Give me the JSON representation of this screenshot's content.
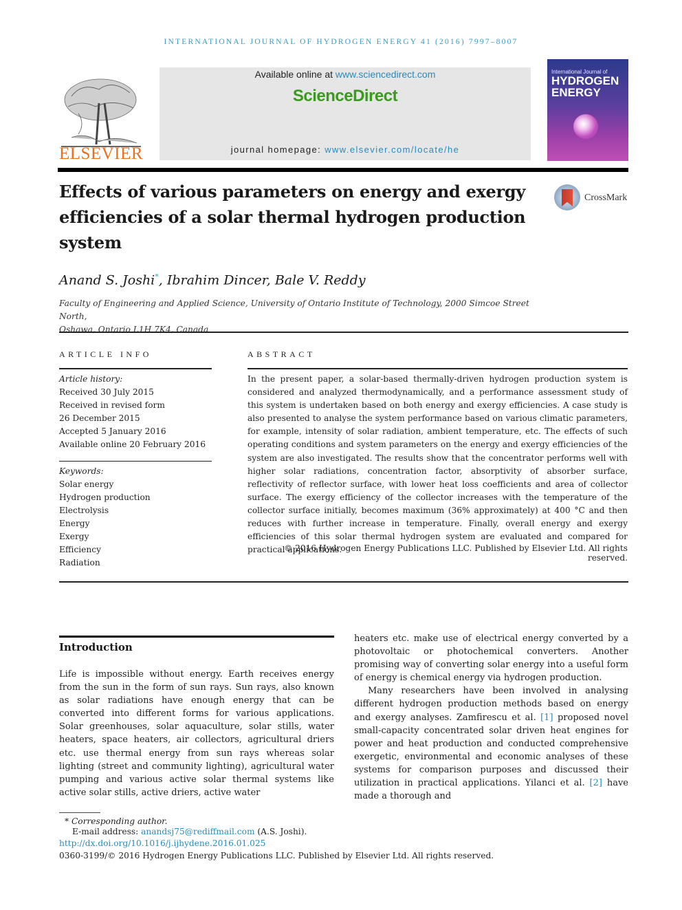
{
  "running_head": "INTERNATIONAL JOURNAL OF HYDROGEN ENERGY 41 (2016) 7997–8007",
  "header": {
    "publisher_logo": "ELSEVIER",
    "available_online_prefix": "Available online at ",
    "available_online_link": "www.sciencedirect.com",
    "brand": "ScienceDirect",
    "homepage_prefix": "journal homepage: ",
    "homepage_link": "www.elsevier.com/locate/he",
    "cover": {
      "line1": "International Journal of",
      "line2": "HYDROGEN",
      "line3": "ENERGY"
    }
  },
  "article": {
    "title": "Effects of various parameters on energy and exergy efficiencies of a solar thermal hydrogen production system",
    "crossmark_label": "CrossMark",
    "authors": [
      {
        "name": "Anand S. Joshi",
        "mark": "*"
      },
      {
        "name": "Ibrahim Dincer",
        "mark": ""
      },
      {
        "name": "Bale V. Reddy",
        "mark": ""
      }
    ],
    "author_sep": ", ",
    "affiliation_line1": "Faculty of Engineering and Applied Science, University of Ontario Institute of Technology, 2000 Simcoe Street North,",
    "affiliation_line2": "Oshawa, Ontario L1H 7K4, Canada"
  },
  "article_info": {
    "heading": "ARTICLE INFO",
    "history_label": "Article history:",
    "history": [
      "Received 30 July 2015",
      "Received in revised form",
      "26 December 2015",
      "Accepted 5 January 2016",
      "Available online 20 February 2016"
    ],
    "keywords_label": "Keywords:",
    "keywords": [
      "Solar energy",
      "Hydrogen production",
      "Electrolysis",
      "Energy",
      "Exergy",
      "Efficiency",
      "Radiation"
    ]
  },
  "abstract": {
    "heading": "ABSTRACT",
    "text": "In the present paper, a solar-based thermally-driven hydrogen production system is considered and analyzed thermodynamically, and a performance assessment study of this system is undertaken based on both energy and exergy efficiencies. A case study is also presented to analyse the system performance based on various climatic parameters, for example, intensity of solar radiation, ambient temperature, etc. The effects of such operating conditions and system parameters on the energy and exergy efficiencies of the system are also investigated. The results show that the concentrator performs well with higher solar radiations, concentration factor, absorptivity of absorber surface, reflectivity of reflector surface, with lower heat loss coefficients and area of collector surface. The exergy efficiency of the collector increases with the temperature of the collector surface initially, becomes maximum (36% approximately) at 400 °C and then reduces with further increase in temperature. Finally, overall energy and exergy efficiencies of this solar thermal hydrogen system are evaluated and compared for practical applications.",
    "copyright": "© 2016 Hydrogen Energy Publications LLC. Published by Elsevier Ltd. All rights reserved."
  },
  "introduction": {
    "heading": "Introduction",
    "para1": "Life is impossible without energy. Earth receives energy from the sun in the form of sun rays. Sun rays, also known as solar radiations have enough energy that can be converted into different forms for various applications. Solar greenhouses, solar aquaculture, solar stills, water heaters, space heaters, air collectors, agricultural driers etc. use thermal energy from sun rays whereas solar lighting (street and community lighting), agricultural water pumping and various active solar thermal systems like active solar stills, active driers, active water",
    "para1_cont": "heaters etc. make use of electrical energy converted by a photovoltaic or photochemical converters. Another promising way of converting solar energy into a useful form of energy is chemical energy via hydrogen production.",
    "para2_a": "Many researchers have been involved in analysing different hydrogen production methods based on energy and exergy analyses. Zamfirescu et al. ",
    "ref1": "[1]",
    "para2_b": " proposed novel small-capacity concentrated solar driven heat engines for power and heat production and conducted comprehensive exergetic, environmental and economic analyses of these systems for comparison purposes and discussed their utilization in practical applications. Yilanci et al. ",
    "ref2": "[2]",
    "para2_c": " have made a thorough and"
  },
  "footnotes": {
    "corresponding": "* Corresponding author.",
    "email_label": "E-mail address: ",
    "email": "anandsj75@rediffmail.com",
    "email_suffix": " (A.S. Joshi).",
    "doi": "http://dx.doi.org/10.1016/j.ijhydene.2016.01.025",
    "issn_copyright": "0360-3199/© 2016 Hydrogen Energy Publications LLC. Published by Elsevier Ltd. All rights reserved."
  }
}
